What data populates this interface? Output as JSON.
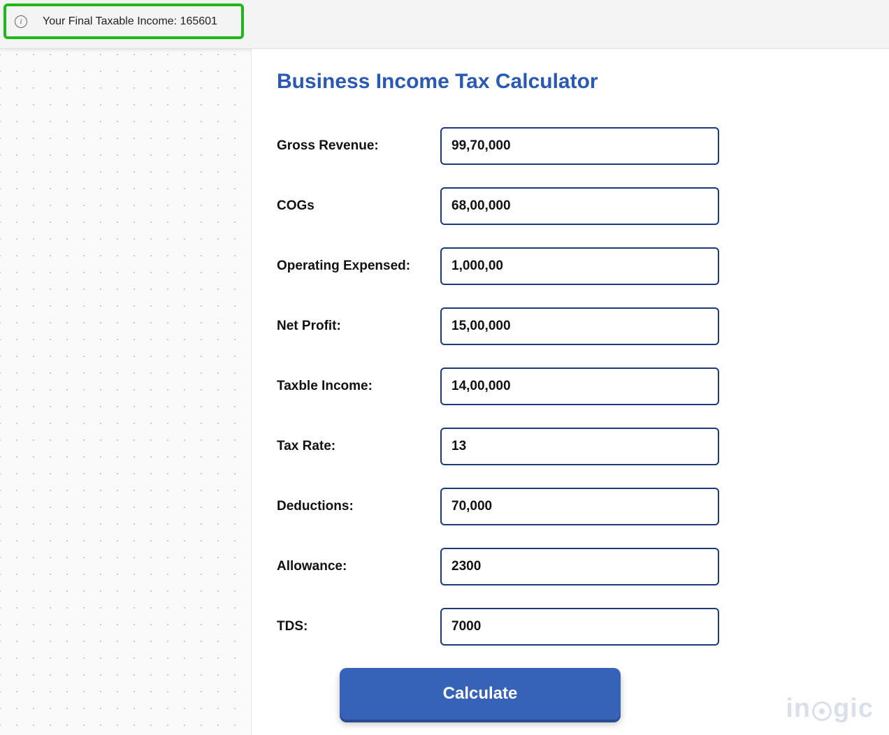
{
  "notification": {
    "text": "Your Final Taxable Income: 165601"
  },
  "form": {
    "title": "Business Income Tax Calculator",
    "fields": [
      {
        "label": "Gross Revenue:",
        "value": "99,70,000",
        "name": "gross-revenue"
      },
      {
        "label": " COGs",
        "value": "68,00,000",
        "name": "cogs"
      },
      {
        "label": "Operating Expensed:",
        "value": "1,000,00",
        "name": "operating-expenses"
      },
      {
        "label": "Net Profit:",
        "value": "15,00,000",
        "name": "net-profit"
      },
      {
        "label": "Taxble Income:",
        "value": "14,00,000",
        "name": "taxable-income"
      },
      {
        "label": "Tax Rate:",
        "value": "13",
        "name": "tax-rate"
      },
      {
        "label": "Deductions:",
        "value": "70,000",
        "name": "deductions"
      },
      {
        "label": "Allowance:",
        "value": "2300",
        "name": "allowance"
      },
      {
        "label": "TDS:",
        "value": "7000",
        "name": "tds"
      }
    ],
    "submit_label": "Calculate"
  },
  "branding": {
    "logo_pre": "in",
    "logo_post": "gic"
  }
}
